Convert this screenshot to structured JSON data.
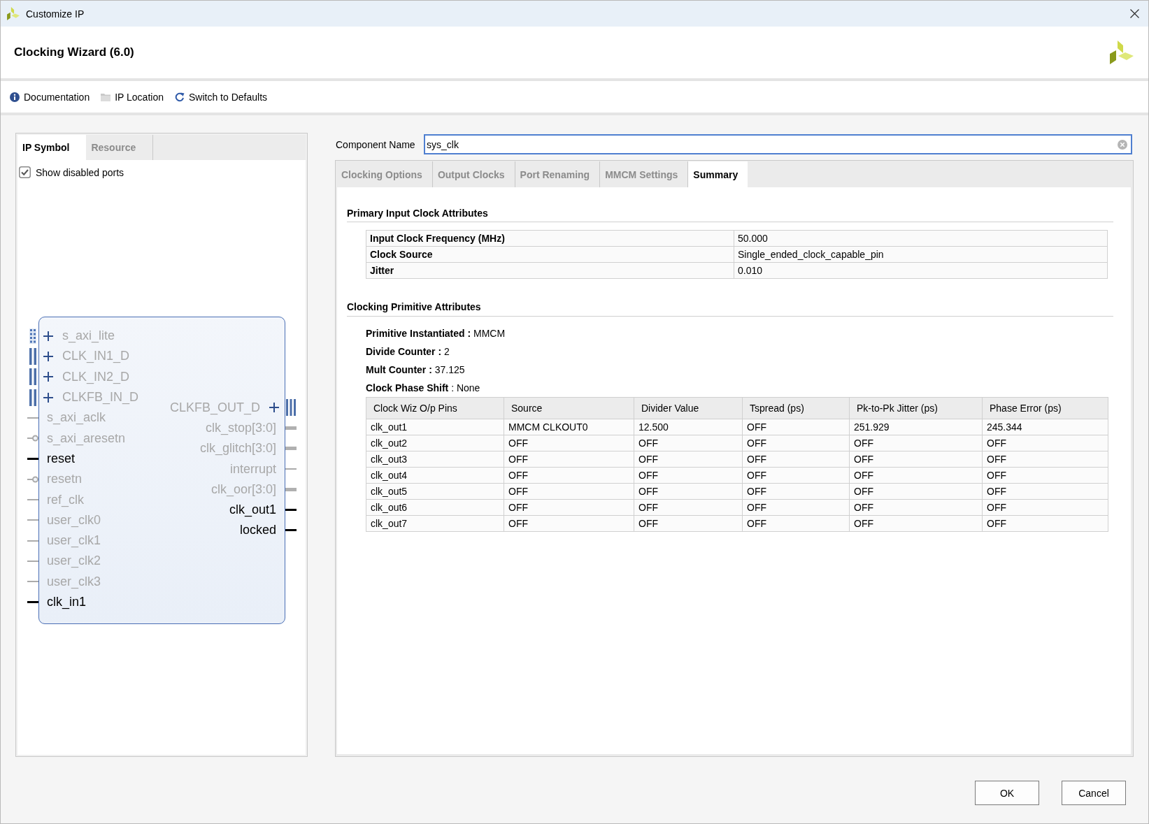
{
  "window": {
    "title": "Customize IP"
  },
  "header": {
    "title": "Clocking Wizard (6.0)"
  },
  "toolbar": [
    {
      "label": "Documentation",
      "kind": "info"
    },
    {
      "label": "IP Location",
      "kind": "folder"
    },
    {
      "label": "Switch to Defaults",
      "kind": "refresh"
    }
  ],
  "symbol_panel": {
    "tabs": [
      {
        "label": "IP Symbol",
        "selected": true
      },
      {
        "label": "Resource",
        "selected": false
      }
    ],
    "show_disabled_ports": {
      "label": "Show disabled ports",
      "checked": true
    },
    "left_ports": [
      {
        "name": "s_axi_lite",
        "kind": "axi",
        "enabled": false
      },
      {
        "name": "CLK_IN1_D",
        "kind": "interface",
        "enabled": false
      },
      {
        "name": "CLK_IN2_D",
        "kind": "interface",
        "enabled": false
      },
      {
        "name": "CLKFB_IN_D",
        "kind": "interface",
        "enabled": false
      },
      {
        "name": "s_axi_aclk",
        "kind": "pin",
        "enabled": false
      },
      {
        "name": "s_axi_aresetn",
        "kind": "inverted",
        "enabled": false
      },
      {
        "name": "reset",
        "kind": "pin",
        "enabled": true
      },
      {
        "name": "resetn",
        "kind": "inverted",
        "enabled": false
      },
      {
        "name": "ref_clk",
        "kind": "pin",
        "enabled": false
      },
      {
        "name": "user_clk0",
        "kind": "pin",
        "enabled": false
      },
      {
        "name": "user_clk1",
        "kind": "pin",
        "enabled": false
      },
      {
        "name": "user_clk2",
        "kind": "pin",
        "enabled": false
      },
      {
        "name": "user_clk3",
        "kind": "pin",
        "enabled": false
      },
      {
        "name": "clk_in1",
        "kind": "pin",
        "enabled": true
      }
    ],
    "right_ports": [
      {
        "name": "CLKFB_OUT_D",
        "kind": "interface",
        "enabled": false
      },
      {
        "name": "clk_stop[3:0]",
        "kind": "bus",
        "enabled": false
      },
      {
        "name": "clk_glitch[3:0]",
        "kind": "bus",
        "enabled": false
      },
      {
        "name": "interrupt",
        "kind": "pin",
        "enabled": false
      },
      {
        "name": "clk_oor[3:0]",
        "kind": "bus",
        "enabled": false
      },
      {
        "name": "clk_out1",
        "kind": "pin",
        "enabled": true
      },
      {
        "name": "locked",
        "kind": "pin",
        "enabled": true
      }
    ]
  },
  "component_name": {
    "label": "Component Name",
    "value": "sys_clk"
  },
  "config_tabs": [
    {
      "label": "Clocking Options",
      "selected": false
    },
    {
      "label": "Output Clocks",
      "selected": false
    },
    {
      "label": "Port Renaming",
      "selected": false
    },
    {
      "label": "MMCM Settings",
      "selected": false
    },
    {
      "label": "Summary",
      "selected": true
    }
  ],
  "summary": {
    "primary_input": {
      "title": "Primary Input Clock Attributes",
      "rows": [
        {
          "name": "Input Clock Frequency (MHz)",
          "value": "50.000"
        },
        {
          "name": "Clock Source",
          "value": "Single_ended_clock_capable_pin"
        },
        {
          "name": "Jitter",
          "value": "0.010"
        }
      ]
    },
    "primitive": {
      "title": "Clocking Primitive Attributes",
      "lines": [
        "**Primitive Instantiated :** MMCM",
        "**Divide Counter :** 2",
        "**Mult Counter :** 37.125",
        "**Clock Phase Shift** : None"
      ]
    },
    "output_table": {
      "columns": [
        "Clock Wiz O/p Pins",
        "Source",
        "Divider Value",
        "Tspread (ps)",
        "Pk-to-Pk Jitter (ps)",
        "Phase Error (ps)"
      ],
      "rows": [
        [
          "clk_out1",
          "MMCM CLKOUT0",
          "12.500",
          "OFF",
          "251.929",
          "245.344"
        ],
        [
          "clk_out2",
          "OFF",
          "OFF",
          "OFF",
          "OFF",
          "OFF"
        ],
        [
          "clk_out3",
          "OFF",
          "OFF",
          "OFF",
          "OFF",
          "OFF"
        ],
        [
          "clk_out4",
          "OFF",
          "OFF",
          "OFF",
          "OFF",
          "OFF"
        ],
        [
          "clk_out5",
          "OFF",
          "OFF",
          "OFF",
          "OFF",
          "OFF"
        ],
        [
          "clk_out6",
          "OFF",
          "OFF",
          "OFF",
          "OFF",
          "OFF"
        ],
        [
          "clk_out7",
          "OFF",
          "OFF",
          "OFF",
          "OFF",
          "OFF"
        ]
      ]
    }
  },
  "buttons": [
    {
      "label": "OK"
    },
    {
      "label": "Cancel"
    }
  ]
}
